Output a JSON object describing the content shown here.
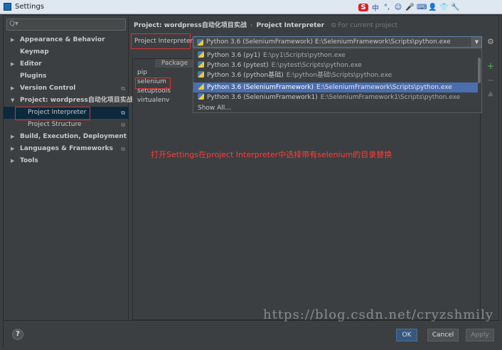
{
  "window": {
    "title": "Settings"
  },
  "tray": {
    "ime": "S",
    "items": [
      "中",
      "°,",
      "☺",
      "🎤",
      "⌨",
      "👤",
      "👕",
      "🔧"
    ]
  },
  "search": {
    "icon": "search-icon",
    "placeholder": "Q▾"
  },
  "sidebar": {
    "items": [
      {
        "label": "Appearance & Behavior",
        "expandable": true
      },
      {
        "label": "Keymap",
        "expandable": false
      },
      {
        "label": "Editor",
        "expandable": true
      },
      {
        "label": "Plugins",
        "expandable": false
      },
      {
        "label": "Version Control",
        "expandable": true
      },
      {
        "label": "Project: wordpress自动化项目实战",
        "expandable": true,
        "expanded": true
      },
      {
        "label": "Project Interpreter",
        "child": true,
        "selected": true
      },
      {
        "label": "Project Structure",
        "child": true
      },
      {
        "label": "Build, Execution, Deployment",
        "expandable": true
      },
      {
        "label": "Languages & Frameworks",
        "expandable": true
      },
      {
        "label": "Tools",
        "expandable": true
      }
    ]
  },
  "breadcrumb": {
    "project": "Project: wordpress自动化项目实战",
    "separator": "›",
    "page": "Project Interpreter",
    "hint": "For current project"
  },
  "interpreter": {
    "label": "Project Interpreter:",
    "selected_name": "Python 3.6 (SeleniumFramework)",
    "selected_path": "E:\\SeleniumFramework\\Scripts\\python.exe"
  },
  "dropdown": {
    "options": [
      {
        "name": "Python 3.6 (py1)",
        "path": "E:\\py1\\Scripts\\python.exe"
      },
      {
        "name": "Python 3.6 (pytest)",
        "path": "E:\\pytest\\Scripts\\python.exe"
      },
      {
        "name": "Python 3.6 (python基础)",
        "path": "E:\\python基础\\Scripts\\python.exe"
      },
      {
        "name": "Python 3.6 (SeleniumFramework)",
        "path": "E:\\SeleniumFramework\\Scripts\\python.exe",
        "selected": true
      },
      {
        "name": "Python 3.6 (SeleniumFramework1)",
        "path": "E:\\SeleniumFramework1\\Scripts\\python.exe"
      }
    ],
    "show_all": "Show All..."
  },
  "packages": {
    "header": "Package",
    "items": [
      "pip",
      "selenium",
      "setuptools",
      "virtualenv"
    ]
  },
  "annotation": "打开Settings在project Interpreter中选择带有selenium的目录替换",
  "footer": {
    "help": "?",
    "ok": "OK",
    "cancel": "Cancel",
    "apply": "Apply"
  },
  "watermark": "https://blog.csdn.net/cryzshmily",
  "colors": {
    "accent": "#4b6eaf",
    "annotation": "#ff3b3b",
    "highlight_box": "#e03030"
  }
}
